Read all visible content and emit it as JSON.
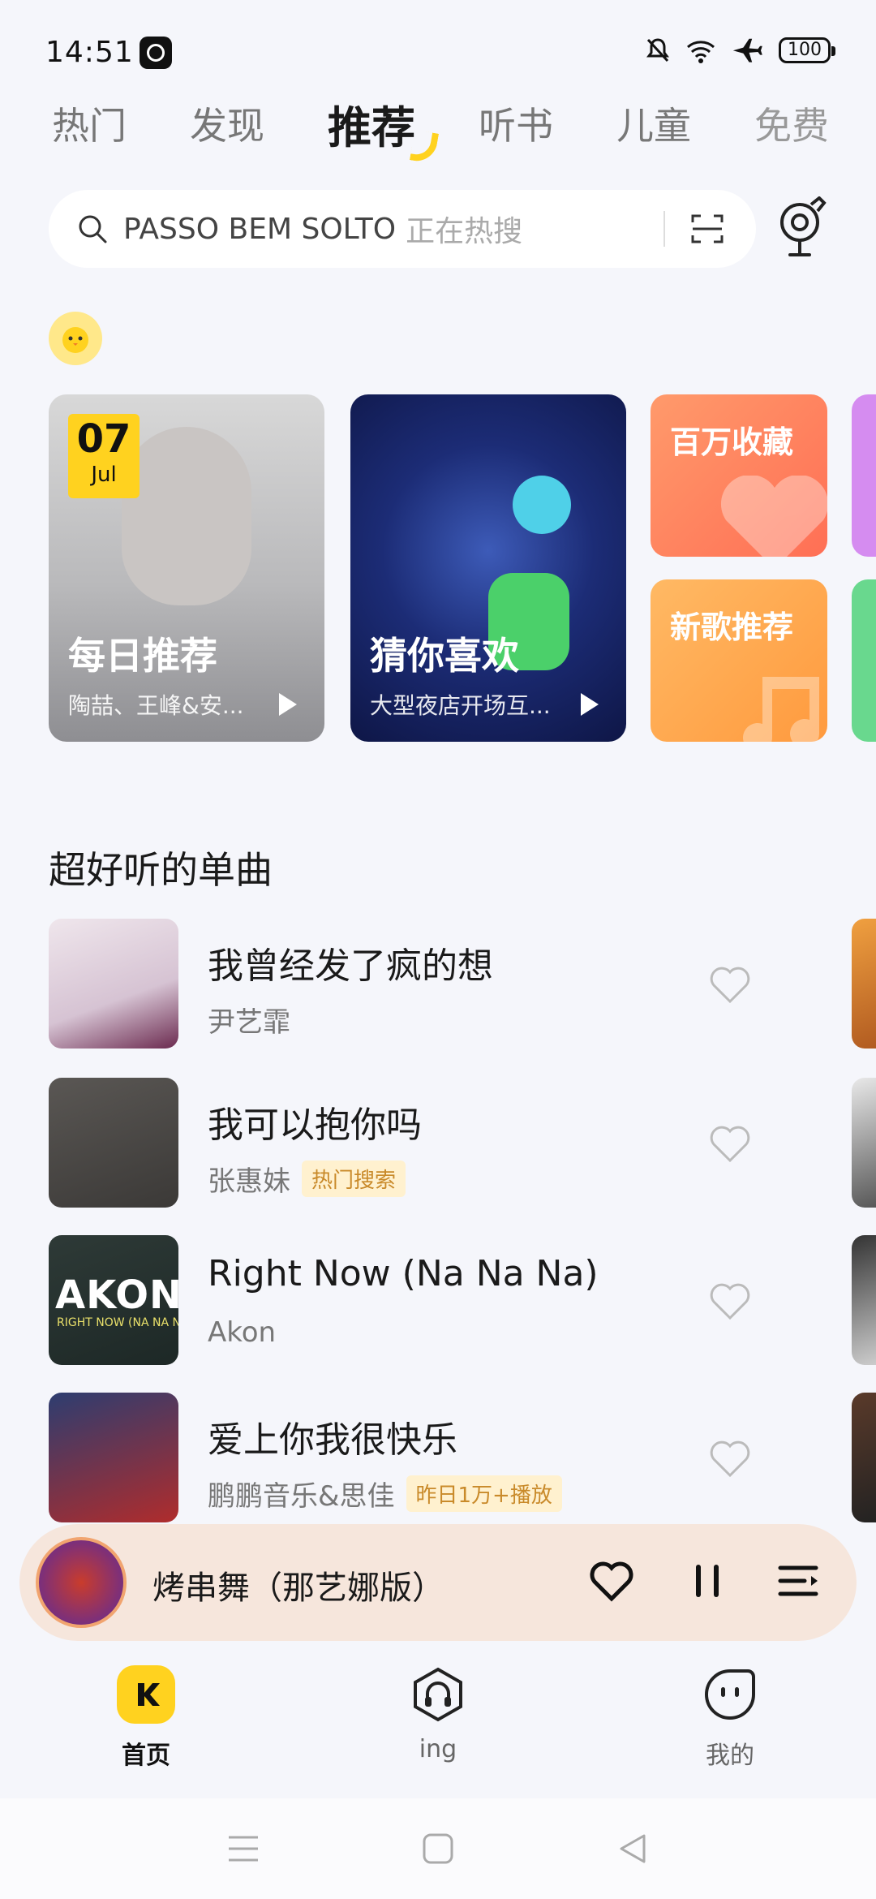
{
  "status_bar": {
    "time": "14:51",
    "battery": "100"
  },
  "tabs": [
    {
      "label": "热门",
      "active": false
    },
    {
      "label": "发现",
      "active": false
    },
    {
      "label": "推荐",
      "active": true
    },
    {
      "label": "听书",
      "active": false
    },
    {
      "label": "儿童",
      "active": false
    },
    {
      "label": "免费",
      "active": false
    }
  ],
  "search": {
    "query": "PASSO BEM SOLTO",
    "hint": "正在热搜"
  },
  "cards": {
    "daily": {
      "day": "07",
      "month": "Jul",
      "title": "每日推荐",
      "subtitle": "陶喆、王峰&安..."
    },
    "guess": {
      "title": "猜你喜欢",
      "subtitle": "大型夜店开场互..."
    },
    "million": {
      "title": "百万收藏"
    },
    "newsong": {
      "title": "新歌推荐"
    }
  },
  "section": {
    "title": "超好听的单曲"
  },
  "songs": [
    {
      "title": "我曾经发了疯的想",
      "artist": "尹艺霏",
      "tag": ""
    },
    {
      "title": "我可以抱你吗",
      "artist": "张惠妹",
      "tag": "热门搜索"
    },
    {
      "title": "Right Now (Na Na Na)",
      "artist": "Akon",
      "tag": ""
    },
    {
      "title": "爱上你我很快乐",
      "artist": "鹏鹏音乐&思佳",
      "tag": "昨日1万+播放"
    }
  ],
  "cover_text": {
    "akon": "AKON",
    "akon_sub": "RIGHT NOW (NA NA NA)"
  },
  "player": {
    "title": "烤串舞（那艺娜版）"
  },
  "bottom_nav": [
    {
      "label": "首页",
      "active": true
    },
    {
      "label": "ing",
      "active": false
    },
    {
      "label": "我的",
      "active": false
    }
  ],
  "colors": {
    "accent": "#ffd21f",
    "background": "#f5f6fb",
    "player_bg": "#f6e6dc"
  }
}
